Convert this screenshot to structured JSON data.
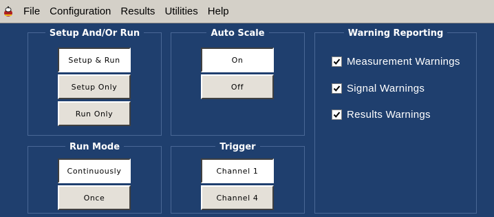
{
  "menu": {
    "logo_icon": "app-logo-icon",
    "items": [
      "File",
      "Configuration",
      "Results",
      "Utilities",
      "Help"
    ]
  },
  "setup_run": {
    "title": "Setup And/Or Run",
    "buttons": [
      "Setup & Run",
      "Setup Only",
      "Run Only"
    ],
    "selected": "Setup & Run"
  },
  "auto_scale": {
    "title": "Auto Scale",
    "buttons": [
      "On",
      "Off"
    ],
    "selected": "On"
  },
  "warning_reporting": {
    "title": "Warning Reporting",
    "items": [
      {
        "label": "Measurement Warnings",
        "checked": true
      },
      {
        "label": "Signal Warnings",
        "checked": true
      },
      {
        "label": "Results Warnings",
        "checked": true
      }
    ]
  },
  "run_mode": {
    "title": "Run Mode",
    "buttons": [
      "Continuously",
      "Once"
    ],
    "selected": "Continuously"
  },
  "trigger": {
    "title": "Trigger",
    "buttons": [
      "Channel 1",
      "Channel 4"
    ],
    "selected": "Channel 1"
  },
  "colors": {
    "background": "#1f3f6e",
    "menubar": "#d4d0c8",
    "button_face": "#e4e0d8",
    "panel_border": "#4a6896"
  }
}
